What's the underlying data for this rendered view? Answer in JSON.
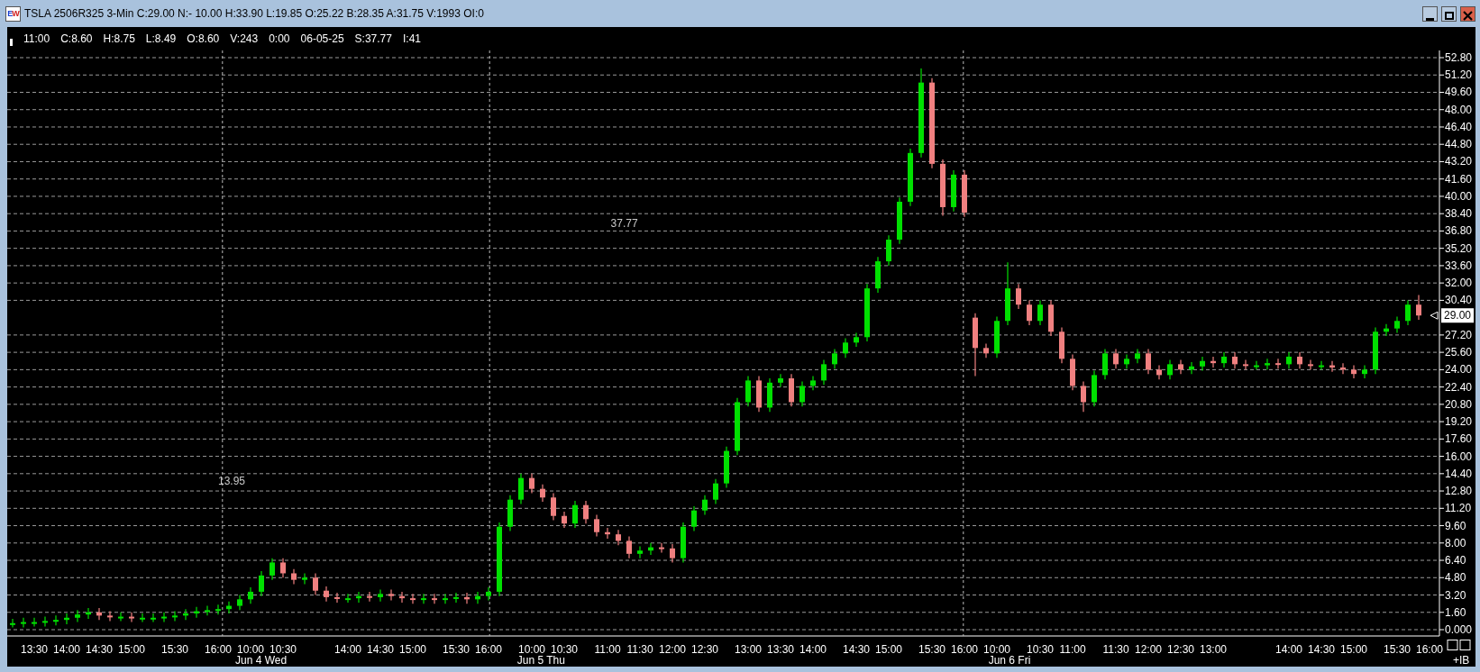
{
  "window": {
    "icon_letters": [
      "E",
      "W"
    ],
    "title": "TSLA 2506R325 3-Min C:29.00 N:- 10.00 H:33.90 L:19.85 O:25.22 B:28.35 A:31.75 V:1993 OI:0"
  },
  "info_bar": [
    "11:00",
    "C:8.60",
    "H:8.75",
    "L:8.49",
    "O:8.60",
    "V:243",
    "0:00",
    "06-05-25",
    "S:37.77",
    "I:41"
  ],
  "chart_data": {
    "type": "candlestick",
    "categories": [
      null,
      null,
      "13:30",
      null,
      null,
      "14:00",
      null,
      null,
      "14:30",
      null,
      null,
      "15:00",
      null,
      null,
      null,
      "15:30",
      null,
      null,
      null,
      "16:00",
      null,
      null,
      "10:00",
      null,
      null,
      "10:30",
      null,
      null,
      null,
      null,
      null,
      "14:00",
      null,
      null,
      "14:30",
      null,
      null,
      "15:00",
      null,
      null,
      null,
      "15:30",
      null,
      null,
      "16:00",
      null,
      null,
      null,
      "10:00",
      null,
      null,
      "10:30",
      null,
      null,
      null,
      "11:00",
      null,
      null,
      "11:30",
      null,
      null,
      "12:00",
      null,
      null,
      "12:30",
      null,
      null,
      null,
      "13:00",
      null,
      null,
      "13:30",
      null,
      null,
      "14:00",
      null,
      null,
      null,
      "14:30",
      null,
      null,
      "15:00",
      null,
      null,
      null,
      "15:30",
      null,
      null,
      "16:00",
      null,
      null,
      "10:00",
      null,
      null,
      null,
      "10:30",
      null,
      null,
      "11:00",
      null,
      null,
      null,
      "11:30",
      null,
      null,
      "12:00",
      null,
      null,
      "12:30",
      null,
      null,
      "13:00",
      null,
      null,
      null,
      null,
      null,
      null,
      "14:00",
      null,
      null,
      "14:30",
      null,
      null,
      "15:00",
      null,
      null,
      null,
      "15:30",
      null,
      null,
      "16:00"
    ],
    "ohlc": [
      [
        0.6,
        1.0,
        0.2,
        0.6
      ],
      [
        0.6,
        1.1,
        0.2,
        0.7
      ],
      [
        0.7,
        1.1,
        0.3,
        0.7
      ],
      [
        0.7,
        1.2,
        0.3,
        0.8
      ],
      [
        0.8,
        1.3,
        0.4,
        0.9
      ],
      [
        0.9,
        1.5,
        0.5,
        1.1
      ],
      [
        1.1,
        1.8,
        0.7,
        1.4
      ],
      [
        1.4,
        2.0,
        1.0,
        1.6
      ],
      [
        1.6,
        2.0,
        0.9,
        1.3
      ],
      [
        1.3,
        1.7,
        0.8,
        1.2
      ],
      [
        1.2,
        1.6,
        0.8,
        1.2
      ],
      [
        1.2,
        1.6,
        0.7,
        1.1
      ],
      [
        1.1,
        1.5,
        0.7,
        1.1
      ],
      [
        1.1,
        1.5,
        0.7,
        1.1
      ],
      [
        1.1,
        1.6,
        0.7,
        1.2
      ],
      [
        1.2,
        1.7,
        0.8,
        1.3
      ],
      [
        1.3,
        1.9,
        0.9,
        1.5
      ],
      [
        1.5,
        2.1,
        1.1,
        1.7
      ],
      [
        1.7,
        2.2,
        1.3,
        1.8
      ],
      [
        1.8,
        2.3,
        1.4,
        1.9
      ],
      [
        1.9,
        2.6,
        1.5,
        2.2
      ],
      [
        2.2,
        3.2,
        1.8,
        2.8
      ],
      [
        2.8,
        3.9,
        2.4,
        3.5
      ],
      [
        3.5,
        5.4,
        3.1,
        5.0
      ],
      [
        5.0,
        6.6,
        4.6,
        6.2
      ],
      [
        6.2,
        6.6,
        4.8,
        5.2
      ],
      [
        5.2,
        5.6,
        4.2,
        4.6
      ],
      [
        4.6,
        5.2,
        4.2,
        4.8
      ],
      [
        4.8,
        5.2,
        3.2,
        3.6
      ],
      [
        3.6,
        4.0,
        2.6,
        3.0
      ],
      [
        3.0,
        3.4,
        2.5,
        2.9
      ],
      [
        2.9,
        3.3,
        2.5,
        2.9
      ],
      [
        2.9,
        3.5,
        2.5,
        3.1
      ],
      [
        3.1,
        3.5,
        2.6,
        3.0
      ],
      [
        3.0,
        3.7,
        2.6,
        3.3
      ],
      [
        3.3,
        3.7,
        2.7,
        3.1
      ],
      [
        3.1,
        3.5,
        2.5,
        2.9
      ],
      [
        2.9,
        3.3,
        2.4,
        2.8
      ],
      [
        2.8,
        3.3,
        2.4,
        2.9
      ],
      [
        2.9,
        3.3,
        2.4,
        2.8
      ],
      [
        2.8,
        3.3,
        2.4,
        2.9
      ],
      [
        2.9,
        3.4,
        2.5,
        3.0
      ],
      [
        3.0,
        3.4,
        2.4,
        2.8
      ],
      [
        2.8,
        3.5,
        2.4,
        3.1
      ],
      [
        3.1,
        3.9,
        2.7,
        3.5
      ],
      [
        3.5,
        9.9,
        3.1,
        9.5
      ],
      [
        9.5,
        12.4,
        9.1,
        12.0
      ],
      [
        12.0,
        14.4,
        11.6,
        14.0
      ],
      [
        14.0,
        14.4,
        12.6,
        13.0
      ],
      [
        13.0,
        13.4,
        11.8,
        12.2
      ],
      [
        12.2,
        12.6,
        10.1,
        10.5
      ],
      [
        10.5,
        10.9,
        9.4,
        9.8
      ],
      [
        9.8,
        11.9,
        9.4,
        11.5
      ],
      [
        11.5,
        11.9,
        9.8,
        10.2
      ],
      [
        10.2,
        10.6,
        8.6,
        9.0
      ],
      [
        9.0,
        9.4,
        8.4,
        8.8
      ],
      [
        8.8,
        9.2,
        7.8,
        8.2
      ],
      [
        8.2,
        8.6,
        6.6,
        7.0
      ],
      [
        7.0,
        7.7,
        6.6,
        7.3
      ],
      [
        7.3,
        8.0,
        6.9,
        7.6
      ],
      [
        7.6,
        8.0,
        7.1,
        7.5
      ],
      [
        7.5,
        7.9,
        6.2,
        6.6
      ],
      [
        6.6,
        9.9,
        6.2,
        9.5
      ],
      [
        9.5,
        11.4,
        9.1,
        11.0
      ],
      [
        11.0,
        12.4,
        10.6,
        12.0
      ],
      [
        12.0,
        13.9,
        11.6,
        13.5
      ],
      [
        13.5,
        16.9,
        13.1,
        16.5
      ],
      [
        16.5,
        21.4,
        16.1,
        21.0
      ],
      [
        21.0,
        23.4,
        20.6,
        23.0
      ],
      [
        23.0,
        23.4,
        20.1,
        20.5
      ],
      [
        20.5,
        23.2,
        20.1,
        22.8
      ],
      [
        22.8,
        23.6,
        22.4,
        23.2
      ],
      [
        23.2,
        23.6,
        20.6,
        21.0
      ],
      [
        21.0,
        22.9,
        20.6,
        22.5
      ],
      [
        22.5,
        23.4,
        22.1,
        23.0
      ],
      [
        23.0,
        24.9,
        22.6,
        24.5
      ],
      [
        24.5,
        25.9,
        24.1,
        25.5
      ],
      [
        25.5,
        26.9,
        25.1,
        26.5
      ],
      [
        26.5,
        27.4,
        26.1,
        27.0
      ],
      [
        27.0,
        31.9,
        26.6,
        31.5
      ],
      [
        31.5,
        34.4,
        31.1,
        34.0
      ],
      [
        34.0,
        36.4,
        33.6,
        36.0
      ],
      [
        36.0,
        39.9,
        35.6,
        39.5
      ],
      [
        39.5,
        44.4,
        39.1,
        44.0
      ],
      [
        44.0,
        51.8,
        43.6,
        50.5
      ],
      [
        50.5,
        50.9,
        42.6,
        43.0
      ],
      [
        43.0,
        43.4,
        38.2,
        39.0
      ],
      [
        39.0,
        42.4,
        38.6,
        42.0
      ],
      [
        42.0,
        42.4,
        38.1,
        38.5
      ],
      [
        28.8,
        29.2,
        23.4,
        26.0
      ],
      [
        26.0,
        26.4,
        25.1,
        25.5
      ],
      [
        25.5,
        28.9,
        25.1,
        28.5
      ],
      [
        28.5,
        33.9,
        28.1,
        31.5
      ],
      [
        31.5,
        31.9,
        29.6,
        30.0
      ],
      [
        30.0,
        30.4,
        28.1,
        28.5
      ],
      [
        28.5,
        30.4,
        28.1,
        30.0
      ],
      [
        30.0,
        30.4,
        27.1,
        27.5
      ],
      [
        27.5,
        27.9,
        24.6,
        25.0
      ],
      [
        25.0,
        25.4,
        22.1,
        22.5
      ],
      [
        22.5,
        22.9,
        20.1,
        21.0
      ],
      [
        21.0,
        23.9,
        20.6,
        23.5
      ],
      [
        23.5,
        25.9,
        23.1,
        25.5
      ],
      [
        25.5,
        25.9,
        24.1,
        24.5
      ],
      [
        24.5,
        25.4,
        24.1,
        25.0
      ],
      [
        25.0,
        25.9,
        24.6,
        25.5
      ],
      [
        25.5,
        25.9,
        23.6,
        24.0
      ],
      [
        24.0,
        24.4,
        23.1,
        23.5
      ],
      [
        23.5,
        24.9,
        23.1,
        24.5
      ],
      [
        24.5,
        24.9,
        23.6,
        24.0
      ],
      [
        24.0,
        24.7,
        23.6,
        24.3
      ],
      [
        24.3,
        25.2,
        23.9,
        24.8
      ],
      [
        24.8,
        25.2,
        24.2,
        24.6
      ],
      [
        24.6,
        25.6,
        24.2,
        25.2
      ],
      [
        25.2,
        25.6,
        24.1,
        24.5
      ],
      [
        24.5,
        24.9,
        24.0,
        24.4
      ],
      [
        24.4,
        24.8,
        24.0,
        24.4
      ],
      [
        24.4,
        25.0,
        24.0,
        24.6
      ],
      [
        24.6,
        25.0,
        24.1,
        24.5
      ],
      [
        24.5,
        25.6,
        24.1,
        25.2
      ],
      [
        25.2,
        25.6,
        24.1,
        24.5
      ],
      [
        24.5,
        24.9,
        24.0,
        24.4
      ],
      [
        24.4,
        24.8,
        24.0,
        24.4
      ],
      [
        24.4,
        24.8,
        23.8,
        24.2
      ],
      [
        24.2,
        24.6,
        23.6,
        24.0
      ],
      [
        24.0,
        24.4,
        23.2,
        23.6
      ],
      [
        23.6,
        24.4,
        23.2,
        24.0
      ],
      [
        24.0,
        27.9,
        23.6,
        27.5
      ],
      [
        27.5,
        28.2,
        27.1,
        27.8
      ],
      [
        27.8,
        28.9,
        27.4,
        28.5
      ],
      [
        28.5,
        30.4,
        28.1,
        30.0
      ],
      [
        30.0,
        30.9,
        28.6,
        29.0
      ],
      null
    ],
    "ylim": [
      0,
      52.8
    ],
    "grid": true,
    "yticks": [
      {
        "value": 0,
        "label": "0.000"
      },
      {
        "value": 1.6,
        "label": "1.60"
      },
      {
        "value": 3.2,
        "label": "3.20"
      },
      {
        "value": 4.8,
        "label": "4.80"
      },
      {
        "value": 6.4,
        "label": "6.40"
      },
      {
        "value": 8.0,
        "label": "8.00"
      },
      {
        "value": 9.6,
        "label": "9.60"
      },
      {
        "value": 11.2,
        "label": "11.20"
      },
      {
        "value": 12.8,
        "label": "12.80"
      },
      {
        "value": 14.4,
        "label": "14.40"
      },
      {
        "value": 16.0,
        "label": "16.00"
      },
      {
        "value": 17.6,
        "label": "17.60"
      },
      {
        "value": 19.2,
        "label": "19.20"
      },
      {
        "value": 20.8,
        "label": "20.80"
      },
      {
        "value": 22.4,
        "label": "22.40"
      },
      {
        "value": 24.0,
        "label": "24.00"
      },
      {
        "value": 25.6,
        "label": "25.60"
      },
      {
        "value": 27.2,
        "label": "27.20"
      },
      {
        "value": 30.4,
        "label": "30.40"
      },
      {
        "value": 32.0,
        "label": "32.00"
      },
      {
        "value": 33.6,
        "label": "33.60"
      },
      {
        "value": 35.2,
        "label": "35.20"
      },
      {
        "value": 36.8,
        "label": "36.80"
      },
      {
        "value": 38.4,
        "label": "38.40"
      },
      {
        "value": 40.0,
        "label": "40.00"
      },
      {
        "value": 41.6,
        "label": "41.60"
      },
      {
        "value": 43.2,
        "label": "43.20"
      },
      {
        "value": 44.8,
        "label": "44.80"
      },
      {
        "value": 46.4,
        "label": "46.40"
      },
      {
        "value": 48.0,
        "label": "48.00"
      },
      {
        "value": 49.6,
        "label": "49.60"
      },
      {
        "value": 51.2,
        "label": "51.20"
      },
      {
        "value": 52.8,
        "label": "52.80"
      }
    ],
    "annotations": [
      "13.95",
      "37.77",
      "29.00",
      "Jun 4 Wed",
      "Jun 5 Thu",
      "Jun 6 Fri"
    ]
  },
  "corner_label": "+IB"
}
